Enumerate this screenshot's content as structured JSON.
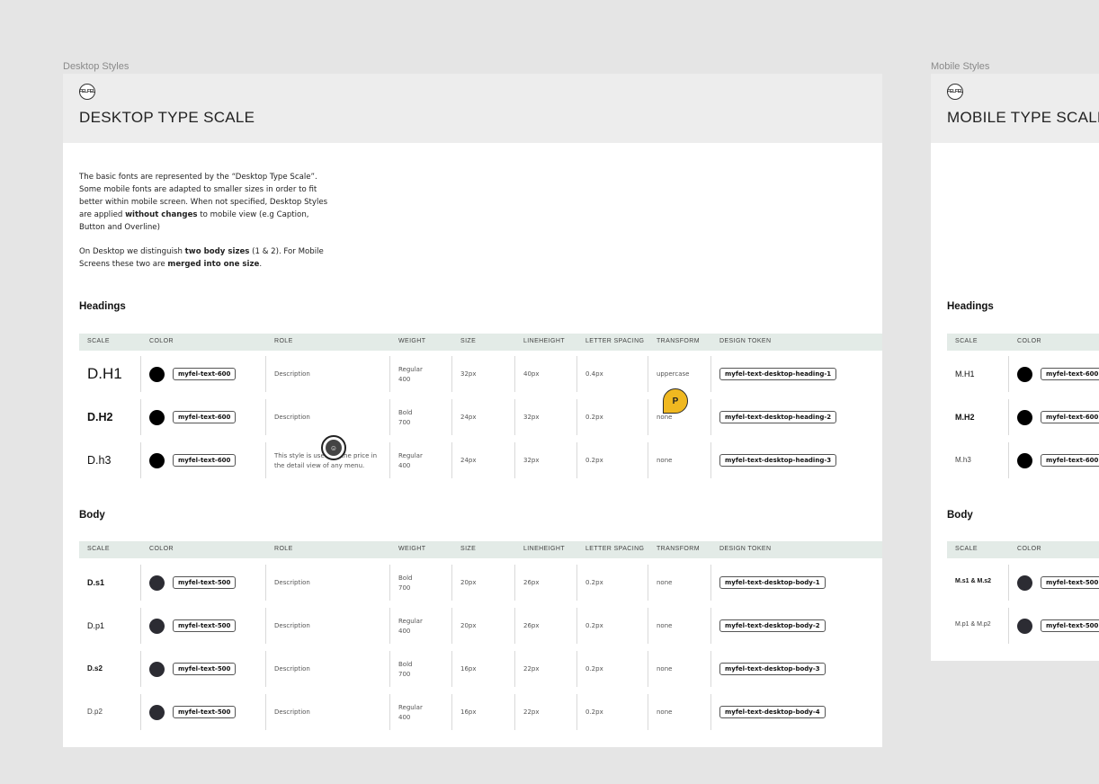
{
  "desktop": {
    "frame_label": "Desktop Styles",
    "logo_text": "FELFEL",
    "title": "DESKTOP TYPE SCALE",
    "intro": {
      "p1_a": "The basic fonts are represented by the “Desktop Type Scale”. Some mobile fonts are adapted to smaller sizes in order to fit better within mobile screen. When not specified, Desktop Styles are applied ",
      "p1_b": "without changes",
      "p1_c": " to mobile view (e.g Caption, Button and Overline)",
      "p2_a": "On Desktop we distinguish ",
      "p2_b": "two body sizes",
      "p2_c": " (1 & 2). For Mobile Screens these two are ",
      "p2_d": "merged into one size",
      "p2_e": "."
    },
    "headings": {
      "title": "Headings",
      "columns": [
        "SCALE",
        "COLOR",
        "ROLE",
        "WEIGHT",
        "SIZE",
        "LINEHEIGHT",
        "LETTER SPACING",
        "TRANSFORM",
        "DESIGN TOKEN"
      ],
      "rows": [
        {
          "scale": "D.H1",
          "color": "myfel-text-600",
          "role": "Description",
          "weight_name": "Regular",
          "weight_value": "400",
          "size": "32px",
          "lineheight": "40px",
          "spacing": "0.4px",
          "transform": "uppercase",
          "token": "myfel-text-desktop-heading-1"
        },
        {
          "scale": "D.H2",
          "color": "myfel-text-600",
          "role": "Description",
          "weight_name": "Bold",
          "weight_value": "700",
          "size": "24px",
          "lineheight": "32px",
          "spacing": "0.2px",
          "transform": "none",
          "token": "myfel-text-desktop-heading-2"
        },
        {
          "scale": "D.h3",
          "color": "myfel-text-600",
          "role": "This style is used for the price in the detail view of any menu.",
          "weight_name": "Regular",
          "weight_value": "400",
          "size": "24px",
          "lineheight": "32px",
          "spacing": "0.2px",
          "transform": "none",
          "token": "myfel-text-desktop-heading-3"
        }
      ]
    },
    "body": {
      "title": "Body",
      "columns": [
        "SCALE",
        "COLOR",
        "ROLE",
        "WEIGHT",
        "SIZE",
        "LINEHEIGHT",
        "LETTER SPACING",
        "TRANSFORM",
        "DESIGN TOKEN"
      ],
      "rows": [
        {
          "scale": "D.s1",
          "color": "myfel-text-500",
          "role": "Description",
          "weight_name": "Bold",
          "weight_value": "700",
          "size": "20px",
          "lineheight": "26px",
          "spacing": "0.2px",
          "transform": "none",
          "token": "myfel-text-desktop-body-1"
        },
        {
          "scale": "D.p1",
          "color": "myfel-text-500",
          "role": "Description",
          "weight_name": "Regular",
          "weight_value": "400",
          "size": "20px",
          "lineheight": "26px",
          "spacing": "0.2px",
          "transform": "none",
          "token": "myfel-text-desktop-body-2"
        },
        {
          "scale": "D.s2",
          "color": "myfel-text-500",
          "role": "Description",
          "weight_name": "Bold",
          "weight_value": "700",
          "size": "16px",
          "lineheight": "22px",
          "spacing": "0.2px",
          "transform": "none",
          "token": "myfel-text-desktop-body-3"
        },
        {
          "scale": "D.p2",
          "color": "myfel-text-500",
          "role": "Description",
          "weight_name": "Regular",
          "weight_value": "400",
          "size": "16px",
          "lineheight": "22px",
          "spacing": "0.2px",
          "transform": "none",
          "token": "myfel-text-desktop-body-4"
        }
      ]
    }
  },
  "mobile": {
    "frame_label": "Mobile Styles",
    "logo_text": "FELFEL",
    "title": "MOBILE TYPE SCALE",
    "headings": {
      "title": "Headings",
      "columns": [
        "SCALE",
        "COLOR"
      ],
      "rows": [
        {
          "scale": "M.H1",
          "color": "myfel-text-600"
        },
        {
          "scale": "M.H2",
          "color": "myfel-text-600"
        },
        {
          "scale": "M.h3",
          "color": "myfel-text-600"
        }
      ]
    },
    "body": {
      "title": "Body",
      "columns": [
        "SCALE",
        "COLOR"
      ],
      "rows": [
        {
          "scale": "M.s1 & M.s2",
          "color": "myfel-text-500"
        },
        {
          "scale": "M.p1 & M.p2",
          "color": "myfel-text-500"
        }
      ]
    }
  },
  "cursors": {
    "collaborator_initial": "P",
    "collaborator_color": "#f0b820"
  },
  "colors": {
    "table_header_bg": "#e3ebe7",
    "frame_header_bg": "#ededed",
    "canvas_bg": "#e5e5e5"
  }
}
